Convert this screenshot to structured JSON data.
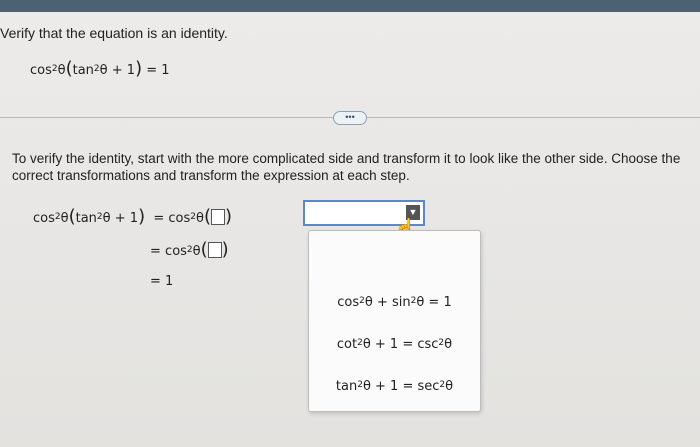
{
  "header": {
    "prompt": "Verify that the equation is an identity."
  },
  "equation": {
    "cos": "cos",
    "exp": "2",
    "theta": "θ",
    "tan": "tan",
    "plus_one": "+ 1",
    "rhs": "= 1"
  },
  "more_button": {
    "label": "•••"
  },
  "instructions": "To verify the identity, start with the more complicated side and transform it to look like the other side. Choose the correct transformations and transform the expression at each step.",
  "work": {
    "lhs_cos": "cos",
    "lhs_tan": "tan",
    "plus_one": "+ 1",
    "step1_eq": "=",
    "step2_eq": "=",
    "step3": "= 1"
  },
  "dropdown": {
    "selected": "",
    "arrow_icon": "chevron-down-icon"
  },
  "menu": {
    "options": [
      {
        "a": "cos",
        "e1": "2",
        "mid": "θ + sin",
        "e2": "2",
        "end": "θ = 1"
      },
      {
        "a": "cot",
        "e1": "2",
        "mid": "θ + 1 = csc",
        "e2": "2",
        "end": "θ"
      },
      {
        "a": "tan",
        "e1": "2",
        "mid": "θ + 1 = sec",
        "e2": "2",
        "end": "θ"
      }
    ]
  }
}
